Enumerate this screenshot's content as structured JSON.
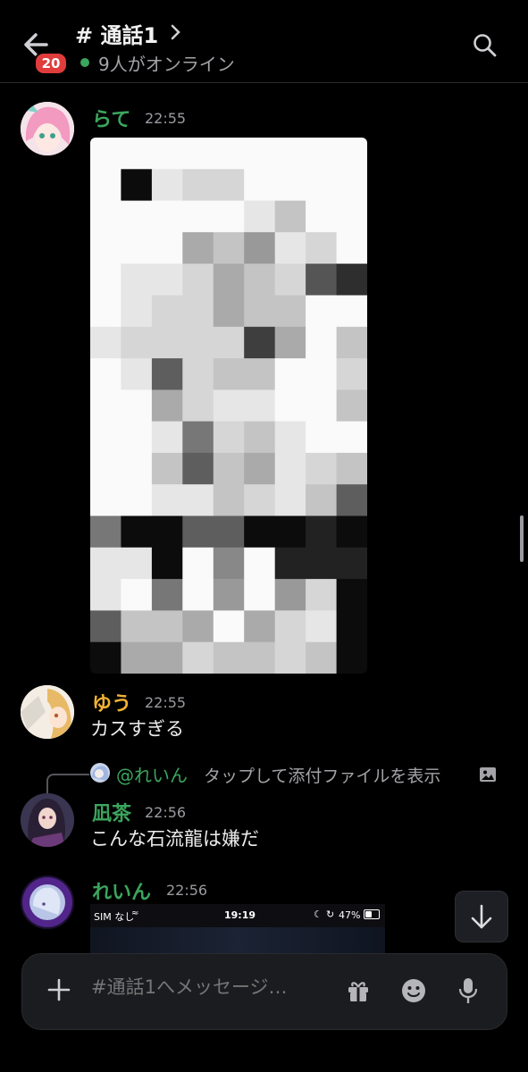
{
  "header": {
    "back_icon": "arrow-left-icon",
    "unread_badge": "20",
    "channel_title": "# 通話1",
    "online_text": "9人がオンライン",
    "online_color": "#3ba55d",
    "search_icon": "search-icon"
  },
  "messages": [
    {
      "author": "らて",
      "time": "22:55",
      "color": "#3ba55d",
      "text": "",
      "attachment": "pixelated-image"
    },
    {
      "author": "ゆう",
      "time": "22:55",
      "color": "#f0b232",
      "text": "カスすぎる"
    },
    {
      "reply": {
        "mention": "@れいん",
        "text": "タップして添付ファイルを表示"
      },
      "author": "凪茶",
      "time": "22:56",
      "color": "#3ba55d",
      "text": "こんな石流龍は嫌だ"
    },
    {
      "author": "れいん",
      "time": "22:56",
      "color": "#3ba55d",
      "text": "",
      "attachment_status": {
        "carrier": "SIM なし",
        "clock": "19:19",
        "battery": "47%"
      }
    }
  ],
  "composer": {
    "placeholder": "#通話1へメッセージ…",
    "plus_icon": "plus-icon",
    "gift_icon": "gift-icon",
    "emoji_icon": "emoji-icon",
    "mic_icon": "microphone-icon"
  },
  "jump_icon": "arrow-down-icon",
  "colors": {
    "background": "#000000",
    "accent_green": "#3ba55d",
    "badge_red": "#e03c3c"
  }
}
